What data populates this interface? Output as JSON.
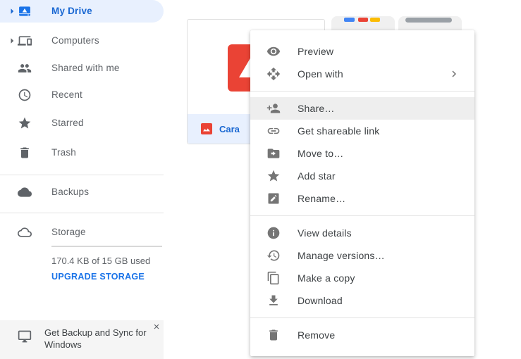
{
  "app": "Google Drive",
  "colors": {
    "accent_blue": "#1a73e8",
    "selected_text_blue": "#1967d2",
    "selected_bg": "#e8f0fe",
    "menu_highlight": "#eeeeee",
    "icon_gray": "#5f6368",
    "thumb_red": "#ea4335",
    "google_blue": "#4285f4",
    "google_red": "#ea4335",
    "google_yellow": "#fbbc04",
    "partial_gray_bar": "#9aa0a6"
  },
  "sidebar": {
    "items": [
      {
        "label": "My Drive",
        "icon": "drive-icon",
        "selected": true,
        "expand_arrow": true
      },
      {
        "label": "Computers",
        "icon": "devices-icon",
        "selected": false,
        "expand_arrow": true
      },
      {
        "label": "Shared with me",
        "icon": "people-icon",
        "selected": false,
        "expand_arrow": false
      },
      {
        "label": "Recent",
        "icon": "clock-icon",
        "selected": false,
        "expand_arrow": false
      },
      {
        "label": "Starred",
        "icon": "star-icon",
        "selected": false,
        "expand_arrow": false
      },
      {
        "label": "Trash",
        "icon": "trash-icon",
        "selected": false,
        "expand_arrow": false
      }
    ],
    "backups": {
      "label": "Backups",
      "icon": "cloud-filled-icon"
    },
    "storage": {
      "label": "Storage",
      "icon": "cloud-outline-icon",
      "usage_text": "170.4 KB of 15 GB used",
      "upgrade_label": "UPGRADE STORAGE"
    },
    "banner": {
      "text": "Get Backup and Sync for Windows",
      "icon": "monitor-icon",
      "close_glyph": "×"
    }
  },
  "content": {
    "selected_file": {
      "name": "Cara",
      "type": "image",
      "type_icon": "image-file-icon"
    }
  },
  "context_menu": {
    "groups": [
      {
        "items": [
          {
            "label": "Preview",
            "icon": "eye-icon",
            "highlighted": false,
            "submenu": false
          },
          {
            "label": "Open with",
            "icon": "open-with-icon",
            "highlighted": false,
            "submenu": true
          }
        ]
      },
      {
        "items": [
          {
            "label": "Share…",
            "icon": "person-add-icon",
            "highlighted": true,
            "submenu": false
          },
          {
            "label": "Get shareable link",
            "icon": "link-icon",
            "highlighted": false,
            "submenu": false
          },
          {
            "label": "Move to…",
            "icon": "folder-move-icon",
            "highlighted": false,
            "submenu": false
          },
          {
            "label": "Add star",
            "icon": "star-icon",
            "highlighted": false,
            "submenu": false
          },
          {
            "label": "Rename…",
            "icon": "rename-icon",
            "highlighted": false,
            "submenu": false
          }
        ]
      },
      {
        "items": [
          {
            "label": "View details",
            "icon": "info-icon",
            "highlighted": false,
            "submenu": false
          },
          {
            "label": "Manage versions…",
            "icon": "history-icon",
            "highlighted": false,
            "submenu": false
          },
          {
            "label": "Make a copy",
            "icon": "copy-icon",
            "highlighted": false,
            "submenu": false
          },
          {
            "label": "Download",
            "icon": "download-icon",
            "highlighted": false,
            "submenu": false
          }
        ]
      },
      {
        "items": [
          {
            "label": "Remove",
            "icon": "trash-icon",
            "highlighted": false,
            "submenu": false
          }
        ]
      }
    ]
  }
}
